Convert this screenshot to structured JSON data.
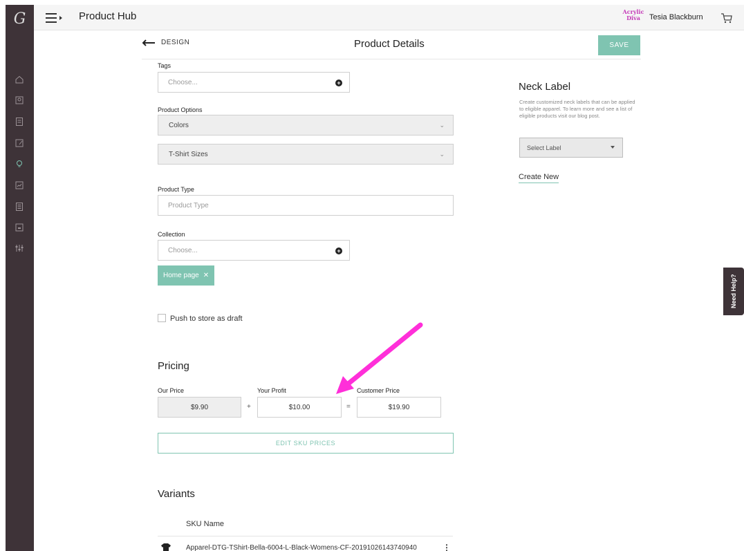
{
  "colors": {
    "sidebar": "#3e3338",
    "accent": "#7fc4b1",
    "annotation_arrow": "#ff2fd9"
  },
  "topbar": {
    "app_title": "Product Hub",
    "brand_logo": "Acrylic Diva",
    "user_name": "Tesia Blackburn"
  },
  "header": {
    "back_label": "DESIGN",
    "page_title": "Product Details",
    "save_label": "SAVE"
  },
  "sidebar": {
    "logo": "G",
    "icons": [
      "home-icon",
      "profile-icon",
      "orders-icon",
      "edit-icon",
      "bulb-icon",
      "reports-icon",
      "list-icon",
      "store-icon",
      "settings-sliders-icon"
    ]
  },
  "form": {
    "tags": {
      "label": "Tags",
      "placeholder": "Choose..."
    },
    "product_options": {
      "label": "Product Options",
      "colors_value": "Colors",
      "sizes_value": "T-Shirt Sizes"
    },
    "product_type": {
      "label": "Product Type",
      "placeholder": "Product Type"
    },
    "collection": {
      "label": "Collection",
      "placeholder": "Choose...",
      "chip": "Home page"
    },
    "draft": {
      "label": "Push to store as draft",
      "checked": false
    }
  },
  "pricing": {
    "title": "Pricing",
    "our_price_label": "Our Price",
    "our_price": "$9.90",
    "your_profit_label": "Your Profit",
    "your_profit": "$10.00",
    "customer_price_label": "Customer Price",
    "customer_price": "$19.90",
    "plus": "+",
    "equals": "=",
    "edit_sku_label": "EDIT SKU PRICES"
  },
  "variants": {
    "title": "Variants",
    "sku_header": "SKU Name",
    "rows": [
      {
        "sku_name": "Apparel-DTG-TShirt-Bella-6004-L-Black-Womens-CF-20191026143740940"
      }
    ]
  },
  "neck_label": {
    "title": "Neck Label",
    "description": "Create customized neck labels that can be applied to eligible apparel. To learn more and see a list of eligible products visit our blog post.",
    "select_value": "Select Label",
    "create_new": "Create New"
  },
  "help": {
    "label": "Need Help?"
  }
}
